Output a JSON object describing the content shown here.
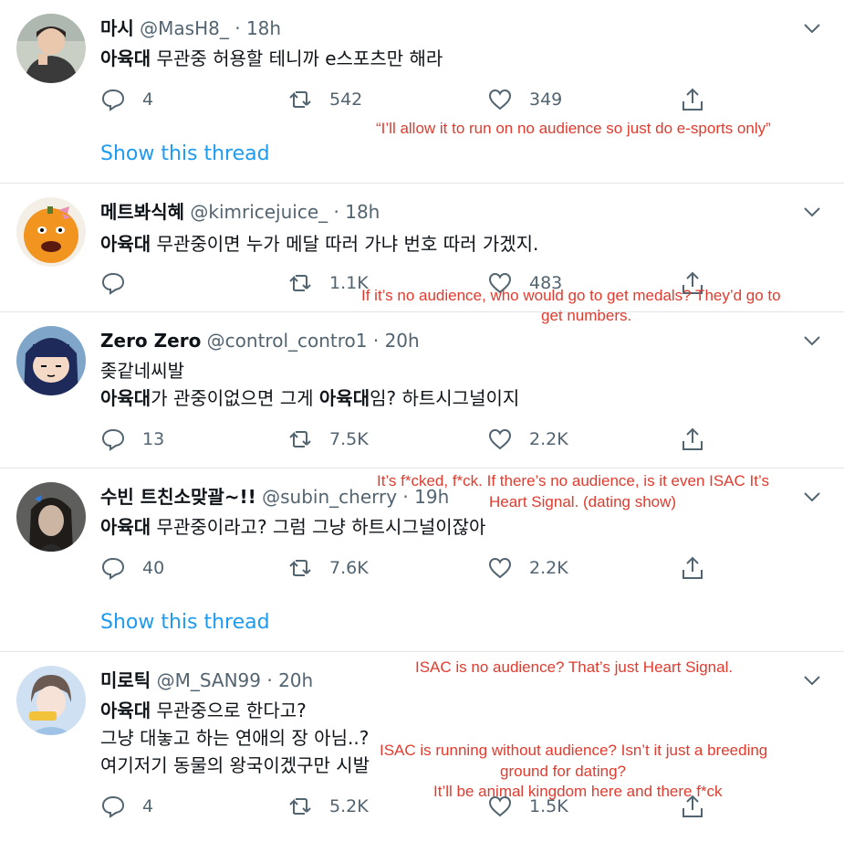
{
  "tweets": [
    {
      "name": "마시",
      "handle": "@MasH8_",
      "time": "18h",
      "text_bold": "아육대",
      "text_rest": " 무관중 허용할 테니까 e스포츠만 해라",
      "replies": "4",
      "retweets": "542",
      "likes": "349",
      "show_thread": "Show this thread",
      "translation": "“I’ll allow it to run on no audience so just do e-sports only”"
    },
    {
      "name": "메트봐식혜",
      "handle": "@kimricejuice_",
      "time": "18h",
      "text_bold": "아육대",
      "text_rest": " 무관중이면 누가 메달 따러 가냐 번호 따러 가겠지.",
      "replies": "",
      "retweets": "1.1K",
      "likes": "483",
      "translation_1": "If it’s no audience, who would go to get medals? They’d go to",
      "translation_2": "get numbers."
    },
    {
      "name": "Zero Zero",
      "handle": "@control_contro1",
      "time": "20h",
      "line1": "좆같네씨발",
      "line2_bold1": "아육대",
      "line2_mid": "가 관중이없으면 그게 ",
      "line2_bold2": "아육대",
      "line2_end": "임? 하트시그널이지",
      "replies": "13",
      "retweets": "7.5K",
      "likes": "2.2K",
      "translation_1": "It’s f*cked, f*ck. If there’s no audience, is it even ISAC  It’s",
      "translation_2": "Heart Signal. (dating show)"
    },
    {
      "name": "수빈 트친소맞괄~!!",
      "handle": "@subin_cherry",
      "time": "19h",
      "text_bold": "아육대",
      "text_rest": " 무관중이라고? 그럼 그냥 하트시그널이잖아",
      "replies": "40",
      "retweets": "7.6K",
      "likes": "2.2K",
      "show_thread": "Show this thread",
      "translation": "ISAC is no audience? That’s just Heart Signal."
    },
    {
      "name": "미로틱",
      "handle": "@M_SAN99",
      "time": "20h",
      "text_bold": "아육대",
      "text_rest": " 무관중으로 한다고?",
      "line2": "그냥 대놓고 하는 연애의 장 아님..?",
      "line3": "여기저기 동물의 왕국이겠구만 시발",
      "replies": "4",
      "retweets": "5.2K",
      "likes": "1.5K",
      "translation_1": "ISAC is running without audience? Isn’t it just a breeding",
      "translation_2": "ground for dating?",
      "translation_3": "It’ll be animal kingdom here and there f*ck"
    }
  ],
  "separator": "·",
  "colors": {
    "link": "#1d9bf0",
    "muted": "#536471",
    "translation": "#e03b2e"
  }
}
